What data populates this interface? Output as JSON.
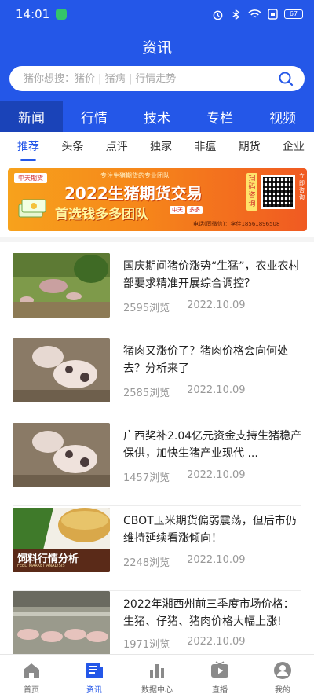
{
  "status_bar": {
    "time": "14:01",
    "battery": "67"
  },
  "header": {
    "title": "资讯",
    "search_placeholder": "猪你想搜：猪价 | 猪病 | 行情走势"
  },
  "main_tabs": [
    {
      "label": "新闻",
      "active": true
    },
    {
      "label": "行情",
      "active": false
    },
    {
      "label": "技术",
      "active": false
    },
    {
      "label": "专栏",
      "active": false
    },
    {
      "label": "视频",
      "active": false
    }
  ],
  "sub_tabs": [
    {
      "label": "推荐",
      "active": true
    },
    {
      "label": "头条",
      "active": false
    },
    {
      "label": "点评",
      "active": false
    },
    {
      "label": "独家",
      "active": false
    },
    {
      "label": "非瘟",
      "active": false
    },
    {
      "label": "期货",
      "active": false
    },
    {
      "label": "企业",
      "active": false
    }
  ],
  "banner": {
    "logo": "中天期货",
    "tagline": "专注生猪期货的专业团队",
    "headline": "2022生猪期货交易",
    "subline": "首选钱多多团队",
    "badge_left": "中天",
    "badge_right": "多多",
    "cta_vertical": "扫码咨询",
    "side_vertical": "立即咨询",
    "phone": "电话(同微信)：李佳18561896508"
  },
  "news": [
    {
      "title": "国庆期间猪价涨势“生猛”，农业农村部要求精准开展综合调控？",
      "views": "2595浏览",
      "date": "2022.10.09",
      "thumb": "pigs-in-field"
    },
    {
      "title": "猪肉又涨价了？猪肉价格会向何处去？分析来了",
      "views": "2585浏览",
      "date": "2022.10.09",
      "thumb": "piglets"
    },
    {
      "title": "广西奖补2.04亿元资金支持生猪稳产保供，加快生猪产业现代 ...",
      "views": "1457浏览",
      "date": "2022.10.09",
      "thumb": "piglets"
    },
    {
      "title": "CBOT玉米期货偏弱震荡，但后市仍维持延续看涨倾向！",
      "views": "2248浏览",
      "date": "2022.10.09",
      "thumb": "feed-analysis",
      "thumb_caption": "饲料行情分析",
      "thumb_subcaption": "FEED MARKET ANALYSIS"
    },
    {
      "title": "2022年湘西州前三季度市场价格：生猪、仔猪、猪肉价格大幅上涨!",
      "views": "1971浏览",
      "date": "2022.10.09",
      "thumb": "pig-farm"
    }
  ],
  "bottom_nav": [
    {
      "label": "首页",
      "icon": "home-icon",
      "active": false
    },
    {
      "label": "资讯",
      "icon": "news-icon",
      "active": true
    },
    {
      "label": "数据中心",
      "icon": "chart-icon",
      "active": false
    },
    {
      "label": "直播",
      "icon": "live-icon",
      "active": false
    },
    {
      "label": "我的",
      "icon": "user-icon",
      "active": false
    }
  ],
  "colors": {
    "brand_blue": "#2457e8",
    "active_tab_bg": "#1a43b8",
    "banner_orange": "#f6861a"
  }
}
